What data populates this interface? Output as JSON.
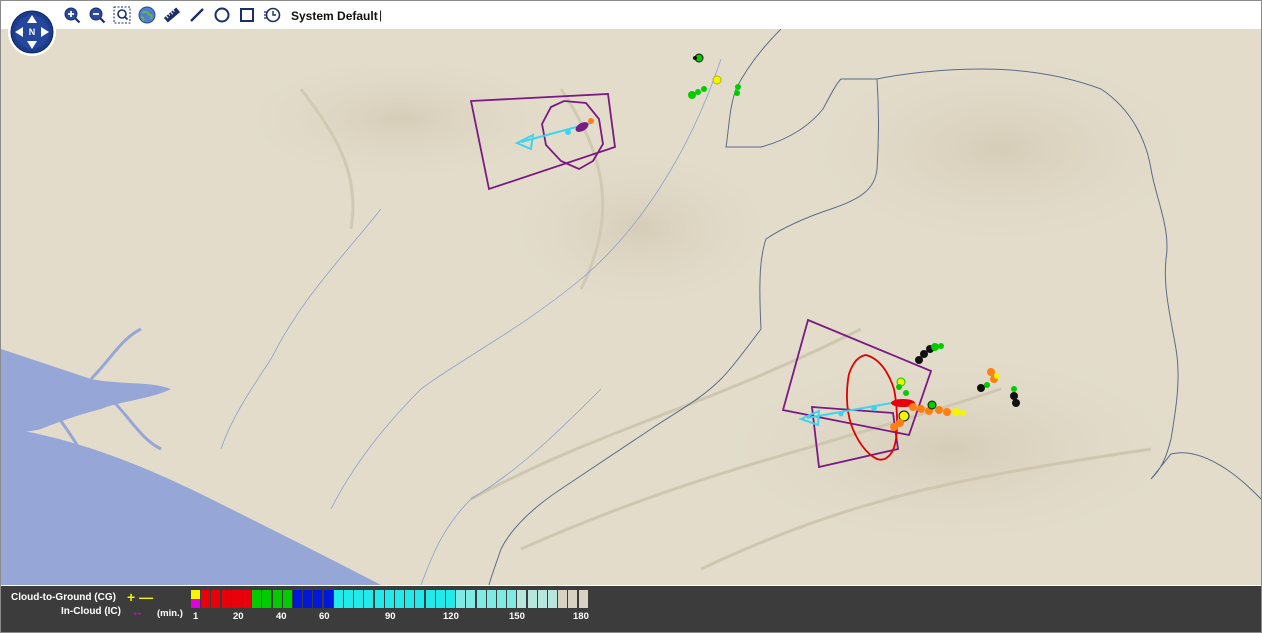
{
  "toolbar": {
    "icons": [
      "zoom-in-icon",
      "zoom-out-icon",
      "zoom-box-icon",
      "globe-icon",
      "ruler-icon",
      "line-draw-icon",
      "circle-draw-icon",
      "rectangle-draw-icon",
      "clock-icon"
    ],
    "profile_label": "System Default",
    "separator": "|"
  },
  "compass": {
    "north_label": "N"
  },
  "legend": {
    "cg_label": "Cloud-to-Ground (CG)",
    "ic_label": "In-Cloud (IC)",
    "cg_symbols": "+ —",
    "ic_symbol": "↔",
    "unit_label": "(min.)",
    "tick_labels": [
      "1",
      "20",
      "40",
      "60",
      "90",
      "120",
      "150",
      "180"
    ],
    "colors": {
      "ic_top": "#f5f500",
      "ic_bottom": "#e000e0",
      "red": "#e8000a",
      "green": "#00cc00",
      "blue": "#0018dd",
      "cyan": "#22eaea",
      "pale": "#d8d2c2"
    }
  },
  "map_colors": {
    "land": "#e3dccb",
    "water": "#96a6d6",
    "borders": "#5c6b8a",
    "storm_polygon": "#7a1a82",
    "track": "#3fd4ee",
    "cell_outline": "#e00000"
  }
}
